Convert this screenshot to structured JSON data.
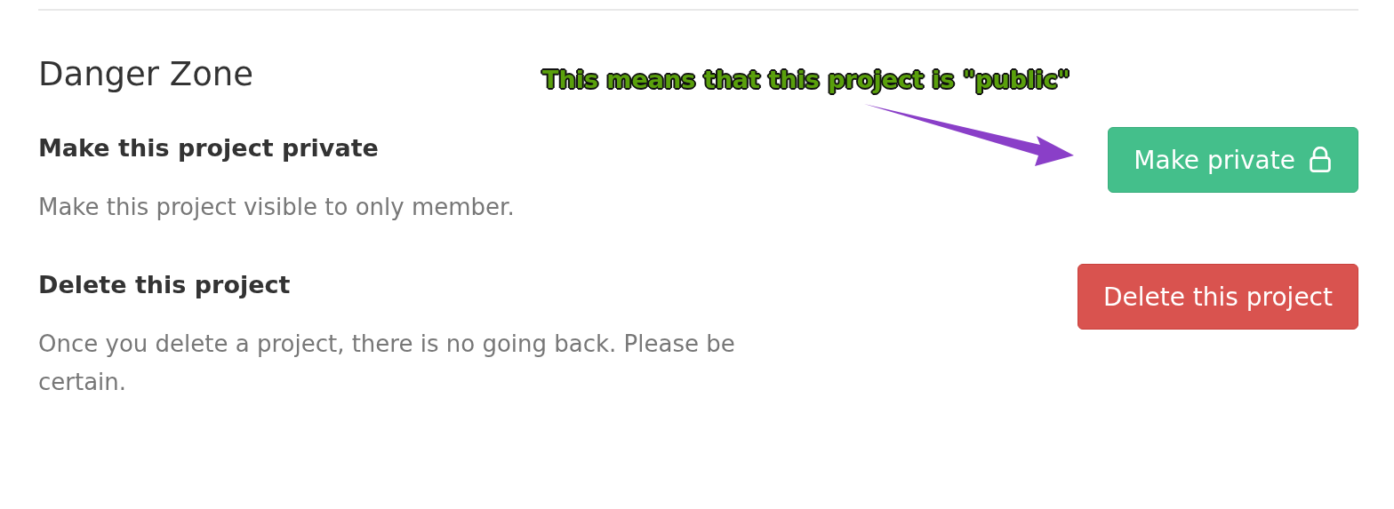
{
  "section": {
    "title": "Danger Zone"
  },
  "settings": [
    {
      "kind": "make_private",
      "heading": "Make this project private",
      "description": "Make this project visible to only member.",
      "button": "Make private"
    },
    {
      "kind": "delete",
      "heading": "Delete this project",
      "description": "Once you delete a project, there is no going back. Please be certain.",
      "button": "Delete this project"
    }
  ],
  "annotation": {
    "text": "This means that this project is \"public\""
  }
}
